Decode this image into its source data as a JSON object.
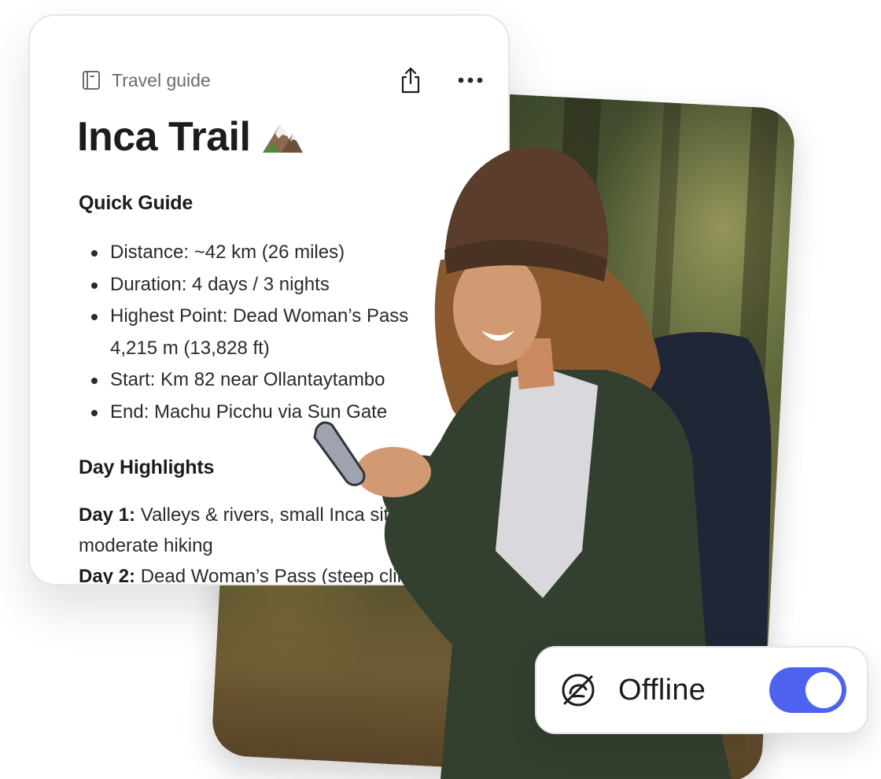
{
  "doc": {
    "breadcrumb_label": "Travel guide",
    "title": "Inca Trail",
    "title_emoji": "🏔️",
    "quick_guide": {
      "heading": "Quick Guide",
      "items": [
        "Distance: ~42 km (26 miles)",
        "Duration: 4 days / 3 nights",
        "Highest Point: Dead Woman’s Pass",
        "4,215 m (13,828 ft)",
        "Start: Km 82 near Ollantaytambo",
        "End: Machu Picchu via Sun Gate"
      ]
    },
    "day_highlights": {
      "heading": "Day Highlights",
      "days": [
        {
          "label": "Day 1:",
          "text": " Valleys & rivers, small Inca sites,",
          "continuation": "moderate hiking"
        },
        {
          "label": "Day 2:",
          "text": " Dead Woman’s Pass (steep climb)"
        }
      ]
    }
  },
  "icons": {
    "breadcrumb": "notebook-icon",
    "share": "share-icon",
    "more": "more-horizontal-icon",
    "offline": "cloud-off-icon"
  },
  "offline": {
    "label": "Offline",
    "enabled": true
  },
  "colors": {
    "accent": "#4d63f0",
    "text": "#1c1c1c",
    "muted": "#6b6b6b"
  }
}
